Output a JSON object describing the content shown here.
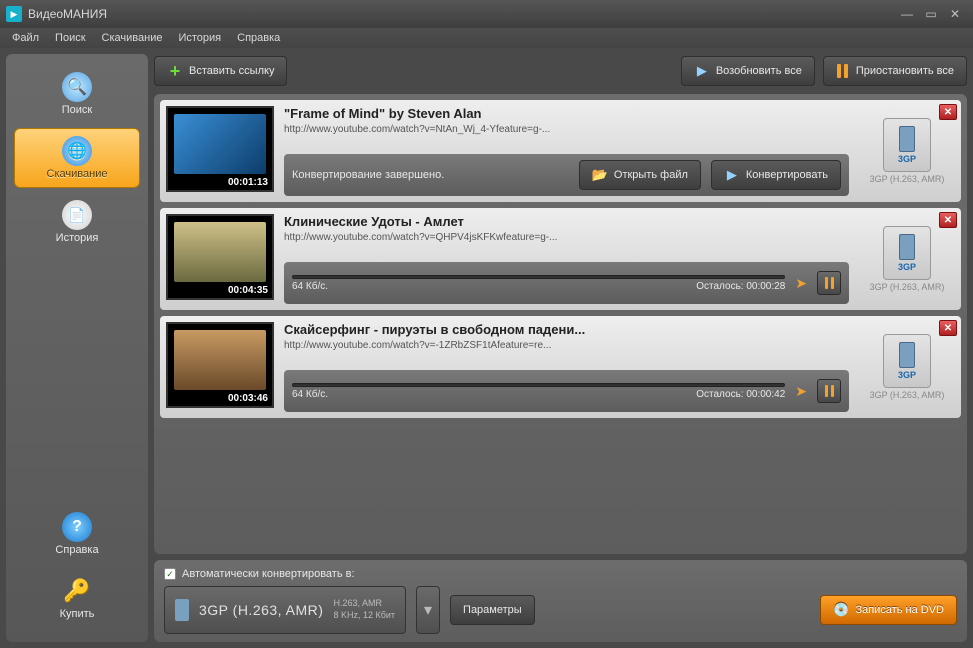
{
  "window": {
    "title": "ВидеоМАНИЯ"
  },
  "menu": {
    "file": "Файл",
    "search": "Поиск",
    "download": "Скачивание",
    "history": "История",
    "help": "Справка"
  },
  "sidebar": {
    "search": "Поиск",
    "download": "Скачивание",
    "history": "История",
    "help": "Справка",
    "buy": "Купить"
  },
  "toolbar": {
    "paste_link": "Вставить ссылку",
    "resume_all": "Возобновить все",
    "pause_all": "Приостановить все"
  },
  "items": [
    {
      "title": "\"Frame of Mind\" by Steven Alan",
      "url": "http://www.youtube.com/watch?v=NtAn_Wj_4-Yfeature=g-...",
      "duration": "00:01:13",
      "status": "Конвертирование завершено.",
      "open_file": "Открыть файл",
      "convert": "Конвертировать",
      "format_label": "3GP",
      "format_desc": "3GP (H.263, AMR)"
    },
    {
      "title": "Клинические Удоты - Амлет",
      "url": "http://www.youtube.com/watch?v=QHPV4jsKFKwfeature=g-...",
      "duration": "00:04:35",
      "speed": "64 Кб/с.",
      "remaining": "Осталось:  00:00:28",
      "format_label": "3GP",
      "format_desc": "3GP (H.263, AMR)"
    },
    {
      "title": "Скайсерфинг - пируэты в свободном падени...",
      "url": "http://www.youtube.com/watch?v=-1ZRbZSF1tAfeature=re...",
      "duration": "00:03:46",
      "speed": "64 Кб/с.",
      "remaining": "Осталось:  00:00:42",
      "format_label": "3GP",
      "format_desc": "3GP (H.263, AMR)"
    }
  ],
  "bottom": {
    "auto_convert": "Автоматически конвертировать в:",
    "format_title": "3GP (H.263, AMR)",
    "format_line1": "H.263, AMR",
    "format_line2": "8 KHz, 12 Кбит",
    "params": "Параметры",
    "burn_dvd": "Записать на DVD"
  }
}
